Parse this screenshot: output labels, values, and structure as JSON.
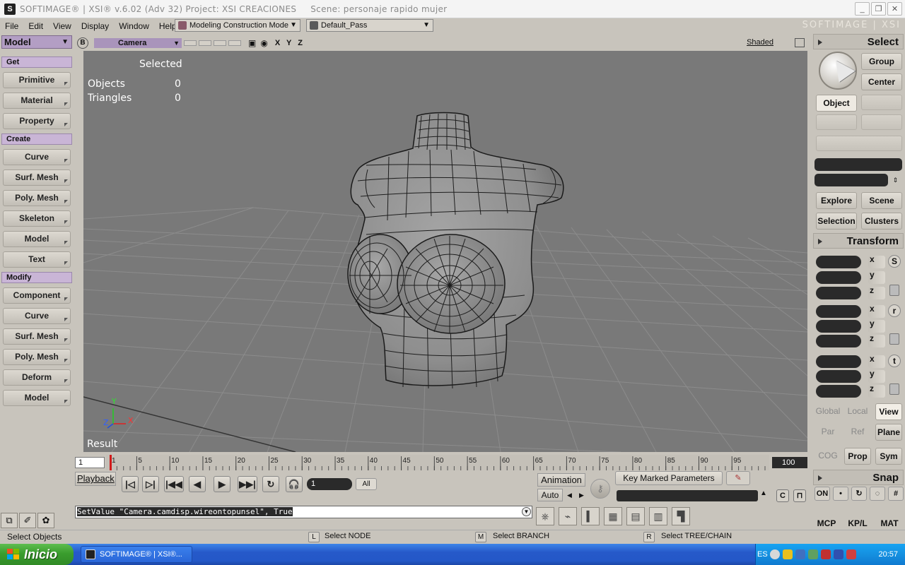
{
  "window": {
    "title": "SOFTIMAGE® | XSI® v.6.02 (Adv 32) Project: XSI CREACIONES",
    "scene": "Scene: personaje rapido mujer",
    "minimize": "_",
    "maximize": "❐",
    "close": "✕"
  },
  "menu": {
    "items": [
      "File",
      "Edit",
      "View",
      "Display",
      "Window",
      "Help"
    ],
    "mode_dropdown": "Modeling Construction Mode",
    "pass_dropdown": "Default_Pass",
    "brand": "SOFTIMAGE | XSI"
  },
  "left_panel": {
    "module": "Model",
    "sections": {
      "get": "Get",
      "create": "Create",
      "modify": "Modify"
    },
    "get_buttons": [
      "Primitive",
      "Material",
      "Property"
    ],
    "create_buttons": [
      "Curve",
      "Surf. Mesh",
      "Poly. Mesh",
      "Skeleton",
      "Model",
      "Text"
    ],
    "modify_buttons": [
      "Component",
      "Curve",
      "Surf. Mesh",
      "Poly. Mesh",
      "Deform",
      "Model"
    ]
  },
  "viewport": {
    "badge": "B",
    "camera": "Camera",
    "axes": "X Y Z",
    "display_mode": "Shaded",
    "selected_label": "Selected",
    "objects_label": "Objects",
    "objects_value": "0",
    "triangles_label": "Triangles",
    "triangles_value": "0",
    "result_label": "Result",
    "gizmo": {
      "x": "X",
      "y": "Y",
      "z": "Z"
    }
  },
  "timeline": {
    "start": "1",
    "end": "100",
    "current_frame": 1,
    "ticks": [
      1,
      5,
      10,
      15,
      20,
      25,
      30,
      35,
      40,
      45,
      50,
      55,
      60,
      65,
      70,
      75,
      80,
      85,
      90,
      95
    ]
  },
  "playback": {
    "label": "Playback",
    "frame": "1",
    "all": "All",
    "buttons": [
      "|◁",
      "▷|",
      "|◀◀",
      "◀",
      "▶",
      "▶▶|",
      "↻",
      "🎧"
    ]
  },
  "animation": {
    "animation_label": "Animation",
    "auto_label": "Auto",
    "key_marked": "Key Marked Parameters",
    "c_label": "C"
  },
  "command": {
    "text": "SetValue \"Camera.camdisp.wireontopunsel\", True"
  },
  "status": {
    "left": "Select Objects",
    "l_key": "L",
    "l_text": "Select NODE",
    "m_key": "M",
    "m_text": "Select BRANCH",
    "r_key": "R",
    "r_text": "Select TREE/CHAIN"
  },
  "right_panel": {
    "select_title": "Select",
    "group": "Group",
    "center": "Center",
    "object": "Object",
    "explore": "Explore",
    "scene": "Scene",
    "selection": "Selection",
    "clusters": "Clusters",
    "transform_title": "Transform",
    "axis": [
      "x",
      "y",
      "z"
    ],
    "srt": [
      "S",
      "r",
      "t"
    ],
    "global": "Global",
    "local": "Local",
    "view": "View",
    "par": "Par",
    "ref": "Ref",
    "plane": "Plane",
    "cog": "COG",
    "prop": "Prop",
    "sym": "Sym",
    "snap_title": "Snap",
    "snap_on": "ON",
    "tabs": [
      "MCP",
      "KP/L",
      "MAT"
    ]
  },
  "taskbar": {
    "start": "Inicio",
    "task": "SOFTIMAGE® | XSI®...",
    "lang": "ES",
    "clock": "20:57"
  },
  "colors": {
    "viewport_bg": "#797979",
    "panel_bg": "#c8c4bc",
    "module_purple": "#b39ec4",
    "timeline_marker": "#d11a1a"
  }
}
